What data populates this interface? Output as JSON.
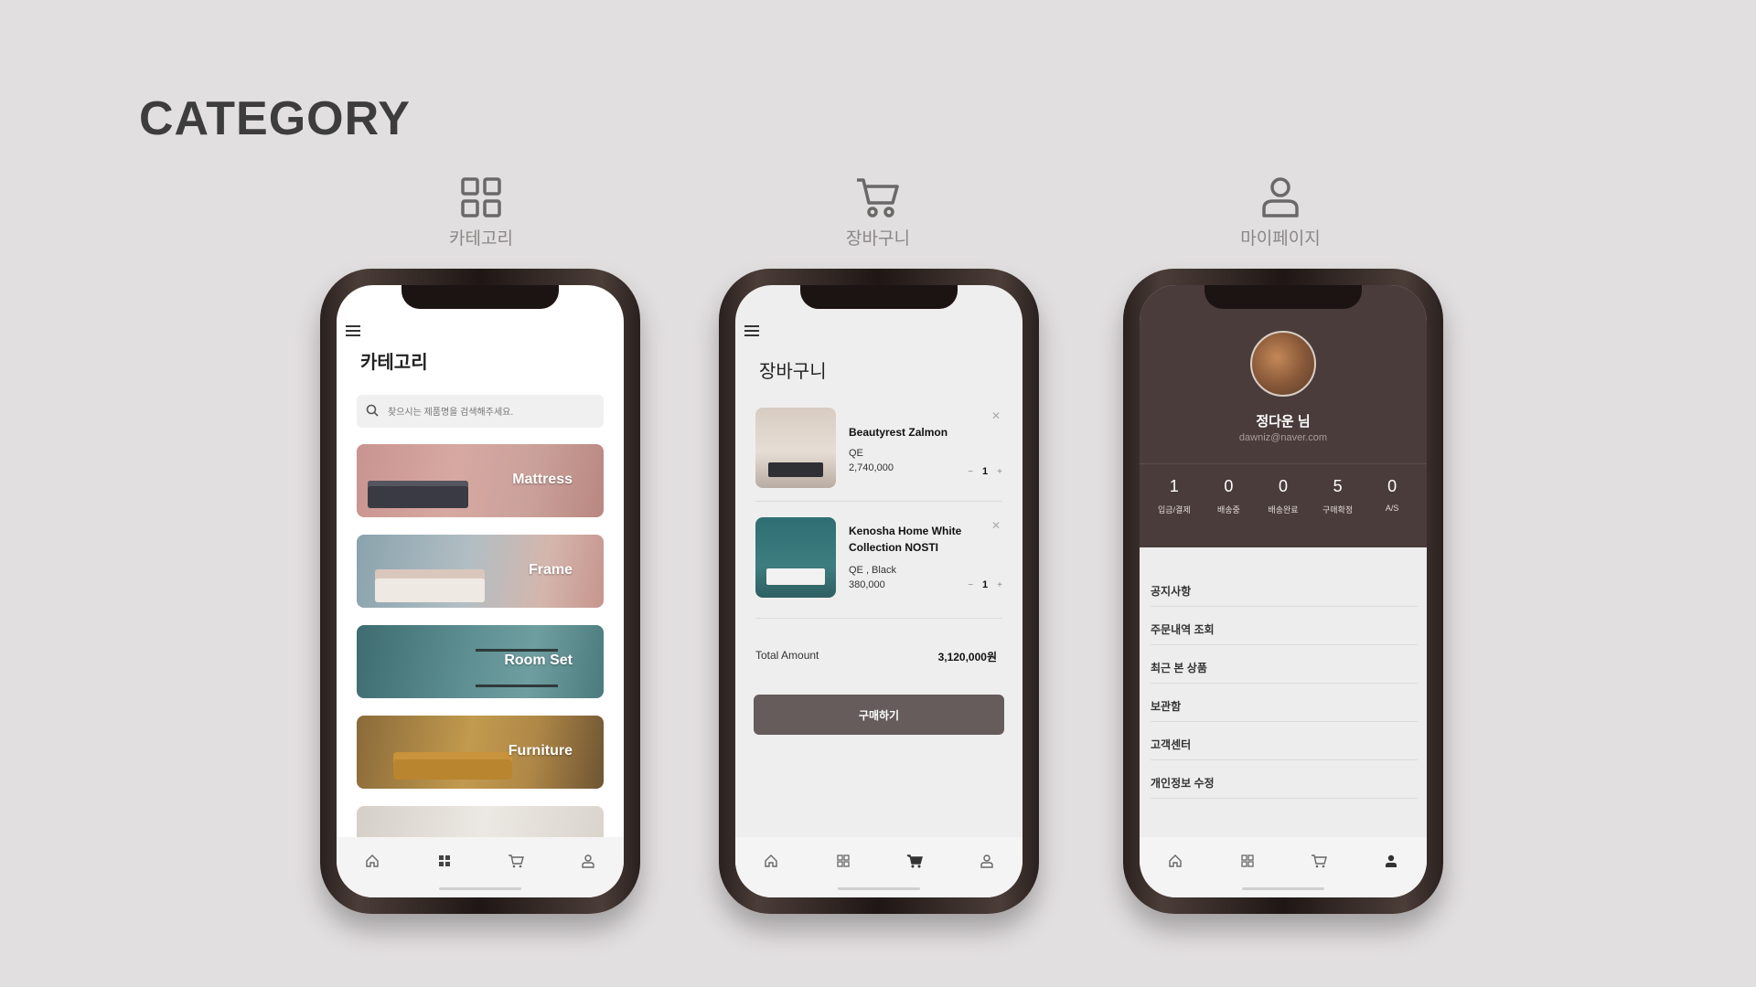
{
  "page": {
    "title": "CATEGORY"
  },
  "sections": [
    {
      "label": "카테고리",
      "icon": "grid-icon"
    },
    {
      "label": "장바구니",
      "icon": "cart-icon"
    },
    {
      "label": "마이페이지",
      "icon": "user-icon"
    }
  ],
  "category_screen": {
    "title": "카테고리",
    "search_placeholder": "찾으시는 제품명을 검색해주세요.",
    "items": [
      {
        "label": "Mattress"
      },
      {
        "label": "Frame"
      },
      {
        "label": "Room Set"
      },
      {
        "label": "Furniture"
      }
    ]
  },
  "cart_screen": {
    "title": "장바구니",
    "items": [
      {
        "name": "Beautyrest Zalmon",
        "option": "QE",
        "price": "2,740,000",
        "qty": "1"
      },
      {
        "name": "Kenosha Home White Collection NOSTI",
        "option": "QE , Black",
        "price": "380,000",
        "qty": "1"
      }
    ],
    "total_label": "Total Amount",
    "total_value": "3,120,000원",
    "buy_label": "구매하기"
  },
  "mypage_screen": {
    "name": "정다운 님",
    "email": "dawniz@naver.com",
    "stats": [
      {
        "value": "1",
        "label": "입금/결제"
      },
      {
        "value": "0",
        "label": "배송중"
      },
      {
        "value": "0",
        "label": "배송완료"
      },
      {
        "value": "5",
        "label": "구매확정"
      },
      {
        "value": "0",
        "label": "A/S"
      }
    ],
    "menu": [
      {
        "label": "공지사항"
      },
      {
        "label": "주문내역 조회"
      },
      {
        "label": "최근 본 상품"
      },
      {
        "label": "보관함"
      },
      {
        "label": "고객센터"
      },
      {
        "label": "개인정보 수정"
      }
    ]
  },
  "tabbar": {
    "icons": [
      "home-icon",
      "grid-icon",
      "cart-icon",
      "user-icon"
    ]
  },
  "colors": {
    "background": "#e2dfe0",
    "accent": "#4a3c3b",
    "button": "#665c5c"
  }
}
